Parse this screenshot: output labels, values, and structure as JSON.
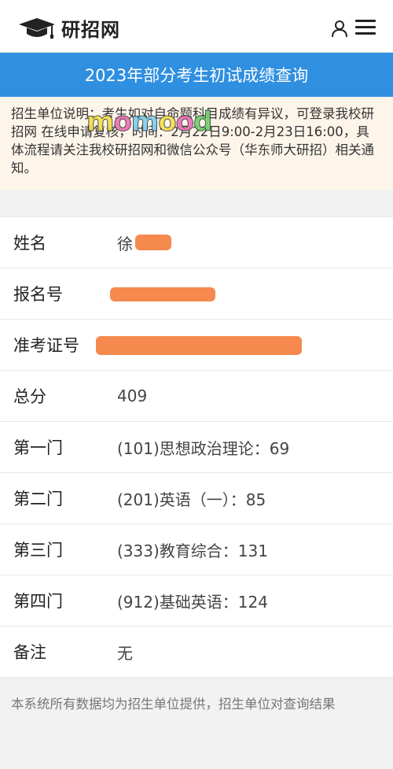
{
  "header": {
    "site_name": "研招网",
    "logo_icon": "graduation-cap-icon",
    "user_icon": "user-icon",
    "menu_icon": "hamburger-menu-icon"
  },
  "banner": {
    "title": "2023年部分考生初试成绩查询"
  },
  "notice": {
    "text": "招生单位说明：考生如对自命题科目成绩有异议，可登录我校研招网 在线申请复核，时间：2月22日9:00-2月23日16:00，具体流程请关注我校研招网和微信公众号（华东师大研招）相关通知。",
    "watermark": "momood"
  },
  "scores": [
    {
      "label": "姓名",
      "value": "徐"
    },
    {
      "label": "报名号",
      "value": ""
    },
    {
      "label": "准考证号",
      "value": ""
    },
    {
      "label": "总分",
      "value": "409"
    },
    {
      "label": "第一门",
      "value": "(101)思想政治理论：69"
    },
    {
      "label": "第二门",
      "value": "(201)英语（一）：85"
    },
    {
      "label": "第三门",
      "value": "(333)教育综合：131"
    },
    {
      "label": "第四门",
      "value": "(912)基础英语：124"
    },
    {
      "label": "备注",
      "value": "无"
    }
  ],
  "footer": {
    "text": "本系统所有数据均为招生单位提供，招生单位对查询结果"
  },
  "colors": {
    "banner": "#2f8fe0",
    "notice_bg": "#fdf5ea",
    "redaction": "#f5894e"
  }
}
